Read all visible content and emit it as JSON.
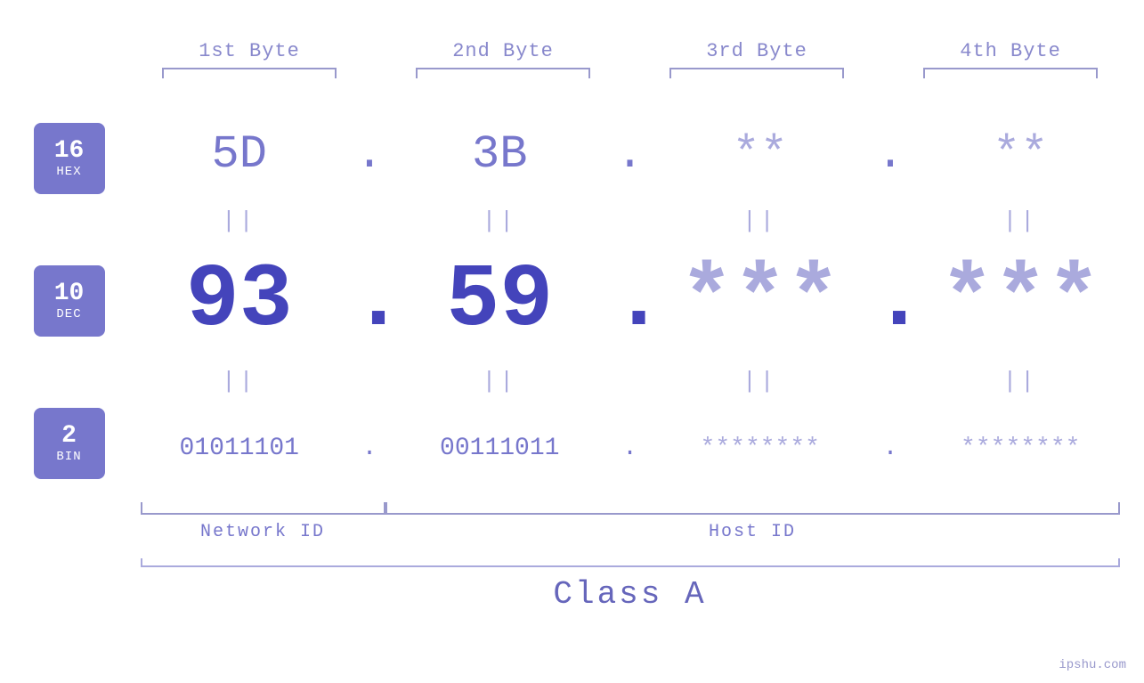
{
  "header": {
    "byte1": "1st Byte",
    "byte2": "2nd Byte",
    "byte3": "3rd Byte",
    "byte4": "4th Byte"
  },
  "badges": [
    {
      "number": "16",
      "label": "HEX"
    },
    {
      "number": "10",
      "label": "DEC"
    },
    {
      "number": "2",
      "label": "BIN"
    }
  ],
  "hex_row": {
    "b1": "5D",
    "b2": "3B",
    "b3": "**",
    "b4": "**",
    "dots": [
      ".",
      ".",
      ".",
      "."
    ]
  },
  "dec_row": {
    "b1": "93",
    "b2": "59",
    "b3": "***",
    "b4": "***",
    "dots": [
      ".",
      ".",
      ".",
      "."
    ]
  },
  "bin_row": {
    "b1": "01011101",
    "b2": "00111011",
    "b3": "********",
    "b4": "********",
    "dots": [
      ".",
      ".",
      ".",
      "."
    ]
  },
  "equals": "||",
  "labels": {
    "network_id": "Network ID",
    "host_id": "Host ID",
    "class": "Class A"
  },
  "watermark": "ipshu.com"
}
